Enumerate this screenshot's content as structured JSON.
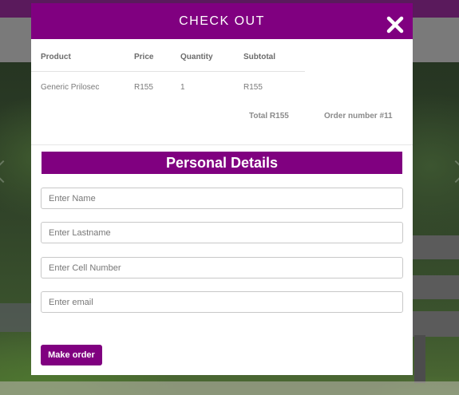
{
  "modal": {
    "title": "CHECK OUT",
    "close_icon": "close-icon"
  },
  "cart": {
    "headers": [
      "Product",
      "Price",
      "Quantity",
      "Subtotal"
    ],
    "rows": [
      [
        "Generic Prilosec",
        "R155",
        "1",
        "R155"
      ]
    ],
    "total": "Total R155",
    "order_number": "Order number #11"
  },
  "personal": {
    "title": "Personal Details",
    "name_placeholder": "Enter Name",
    "lastname_placeholder": "Enter Lastname",
    "cell_placeholder": "Enter Cell Number",
    "email_placeholder": "Enter email",
    "submit_label": "Make order"
  },
  "colors": {
    "accent": "#800080",
    "overlay_bg": "#2b2b2b"
  }
}
